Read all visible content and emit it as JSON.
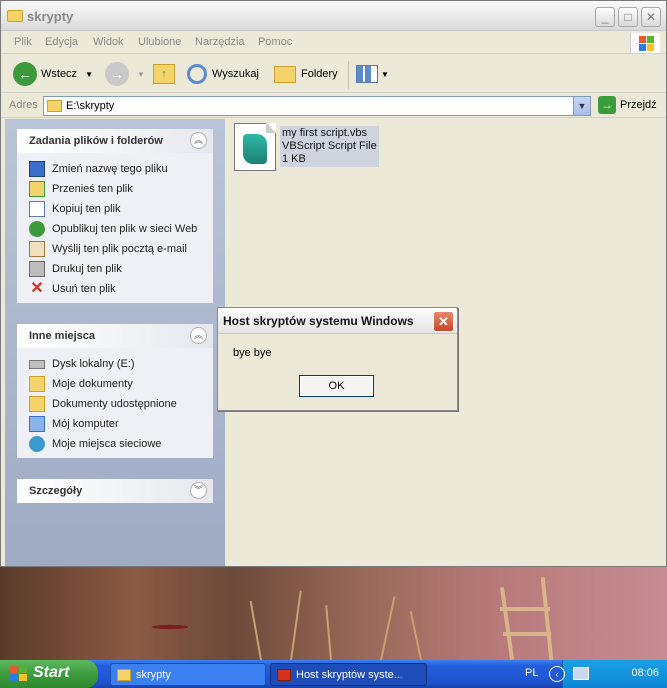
{
  "window": {
    "title": "skrypty",
    "menu": [
      "Plik",
      "Edycja",
      "Widok",
      "Ulubione",
      "Narzędzia",
      "Pomoc"
    ],
    "toolbar": {
      "back": "Wstecz",
      "search": "Wyszukaj",
      "folders": "Foldery"
    },
    "address": {
      "label": "Adres",
      "path": "E:\\skrypty",
      "go": "Przejdź"
    }
  },
  "tasks_panel": {
    "title": "Zadania plików i folderów",
    "items": [
      "Zmień nazwę tego pliku",
      "Przenieś ten plik",
      "Kopiuj ten plik",
      "Opublikuj ten plik w sieci Web",
      "Wyślij ten plik pocztą e-mail",
      "Drukuj ten plik",
      "Usuń ten plik"
    ]
  },
  "places_panel": {
    "title": "Inne miejsca",
    "items": [
      "Dysk lokalny (E:)",
      "Moje dokumenty",
      "Dokumenty udostępnione",
      "Mój komputer",
      "Moje miejsca sieciowe"
    ]
  },
  "details_panel": {
    "title": "Szczegóły"
  },
  "file": {
    "name": "my first  script.vbs",
    "type": "VBScript Script File",
    "size": "1 KB"
  },
  "dialog": {
    "title": "Host skryptów systemu Windows",
    "message": "bye bye",
    "ok": "OK"
  },
  "taskbar": {
    "start": "Start",
    "tasks": [
      "skrypty",
      "Host skryptów syste..."
    ],
    "language": "PL",
    "clock": "08:06"
  },
  "colors": {
    "taskbar_blue": "#245edb",
    "start_green": "#3c9a3c",
    "close_red": "#c8452a"
  }
}
